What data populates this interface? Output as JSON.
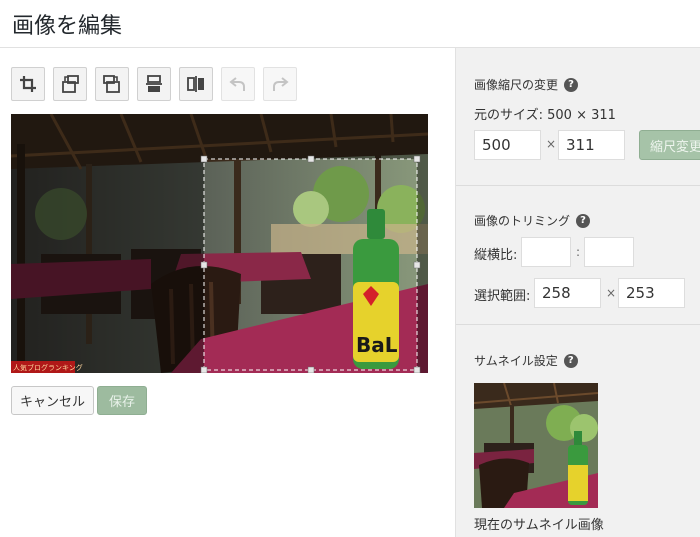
{
  "page": {
    "title": "画像を編集"
  },
  "toolbar": {
    "buttons": [
      {
        "name": "crop",
        "icon": "crop-icon",
        "enabled": true
      },
      {
        "name": "rotate-left",
        "icon": "rotate-left-icon",
        "enabled": true
      },
      {
        "name": "rotate-right",
        "icon": "rotate-right-icon",
        "enabled": true
      },
      {
        "name": "flip-vertical",
        "icon": "flip-vertical-icon",
        "enabled": true
      },
      {
        "name": "flip-horizontal",
        "icon": "flip-horizontal-icon",
        "enabled": true
      },
      {
        "name": "undo",
        "icon": "undo-icon",
        "enabled": false
      },
      {
        "name": "redo",
        "icon": "redo-icon",
        "enabled": false
      }
    ]
  },
  "image": {
    "watermark": "人気ブログランキング"
  },
  "actions": {
    "cancel": "キャンセル",
    "save": "保存"
  },
  "scale": {
    "title": "画像縮尺の変更",
    "original_label": "元のサイズ: 500 × 311",
    "width": "500",
    "height": "311",
    "times": "×",
    "button": "縮尺変更"
  },
  "crop": {
    "title": "画像のトリミング",
    "aspect_label": "縦横比:",
    "aspect_w": "",
    "aspect_h": "",
    "colon": ":",
    "selection_label": "選択範囲:",
    "sel_w": "258",
    "sel_h": "253",
    "times": "×"
  },
  "thumbnail": {
    "title": "サムネイル設定",
    "caption": "現在のサムネイル画像"
  },
  "colors": {
    "accent": "#9dbb9f",
    "sidebar_bg": "#f1f1f1",
    "tablecloth": "#a32b55"
  }
}
